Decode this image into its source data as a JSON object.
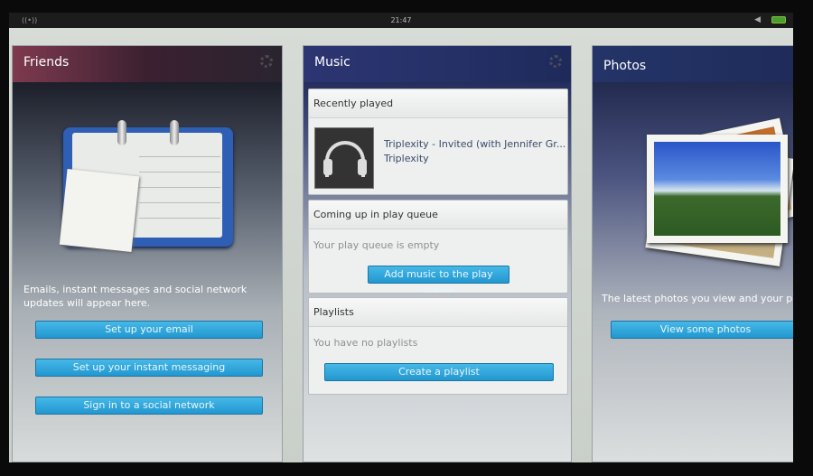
{
  "statusbar": {
    "time": "21:47",
    "signal_glyph": "((•))",
    "volume_glyph": "◀"
  },
  "friends": {
    "title": "Friends",
    "description": "Emails, instant messages and social network updates will appear here.",
    "buttons": [
      {
        "label": "Set up your email"
      },
      {
        "label": "Set up your instant messaging"
      },
      {
        "label": "Sign in to a social network"
      }
    ]
  },
  "music": {
    "title": "Music",
    "recent": {
      "title": "Recently played",
      "track": "Triplexity - Invited (with Jennifer Gr...",
      "artist": "Triplexity"
    },
    "queue": {
      "title": "Coming up in play queue",
      "empty_text": "Your play queue is empty",
      "button": "Add music to the play queue"
    },
    "playlists": {
      "title": "Playlists",
      "empty_text": "You have no playlists",
      "button": "Create a playlist"
    }
  },
  "photos": {
    "title": "Photos",
    "description": "The latest photos you view and your pho will appear here.",
    "button": "View some photos"
  },
  "colors": {
    "button": "#2a9fd6",
    "statusbar": "#1c1c1c",
    "battery": "#4c9e2a"
  }
}
